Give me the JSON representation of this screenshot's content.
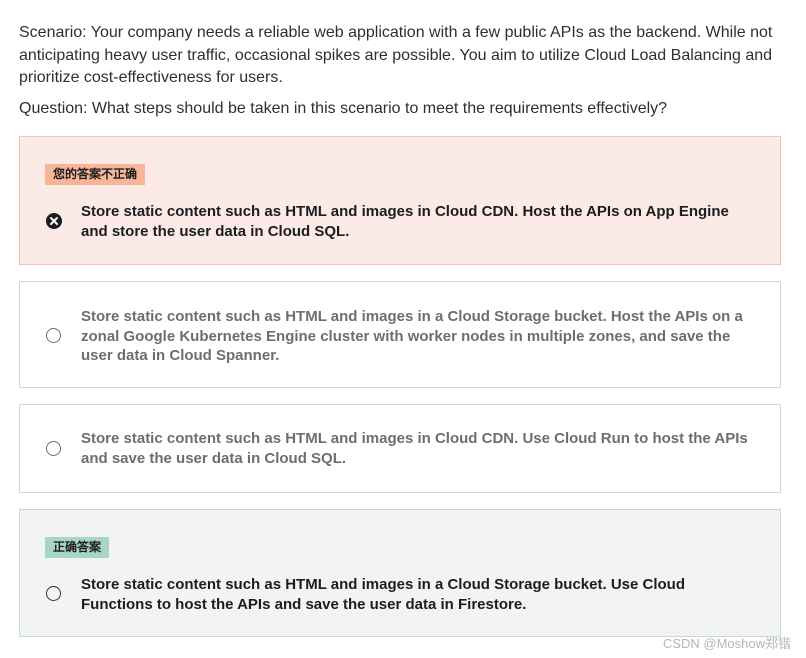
{
  "scenario": "Scenario: Your company needs a reliable web application with a few public APIs as the backend. While not anticipating heavy user traffic, occasional spikes are possible. You aim to utilize Cloud Load Balancing and prioritize cost-effectiveness for users.",
  "question": "Question: What steps should be taken in this scenario to meet the requirements effectively?",
  "badges": {
    "incorrect": "您的答案不正确",
    "correct": "正确答案"
  },
  "options": [
    {
      "text": "Store static content such as HTML and images in Cloud CDN. Host the APIs on App Engine and store the user data in Cloud SQL.",
      "state": "selected-incorrect"
    },
    {
      "text": "Store static content such as HTML and images in a Cloud Storage bucket. Host the APIs on a zonal Google Kubernetes Engine cluster with worker nodes in multiple zones, and save the user data in Cloud Spanner.",
      "state": "unselected"
    },
    {
      "text": "Store static content such as HTML and images in Cloud CDN. Use Cloud Run to host the APIs and save the user data in Cloud SQL.",
      "state": "unselected"
    },
    {
      "text": "Store static content such as HTML and images in a Cloud Storage bucket. Use Cloud Functions to host the APIs and save the user data in Firestore.",
      "state": "correct"
    }
  ],
  "watermark": "CSDN @Moshow郑锴",
  "colors": {
    "incorrect_bg": "#fceae6",
    "incorrect_badge": "#f8b698",
    "correct_bg": "#f1f4f3",
    "correct_badge": "#a7d6c5"
  }
}
